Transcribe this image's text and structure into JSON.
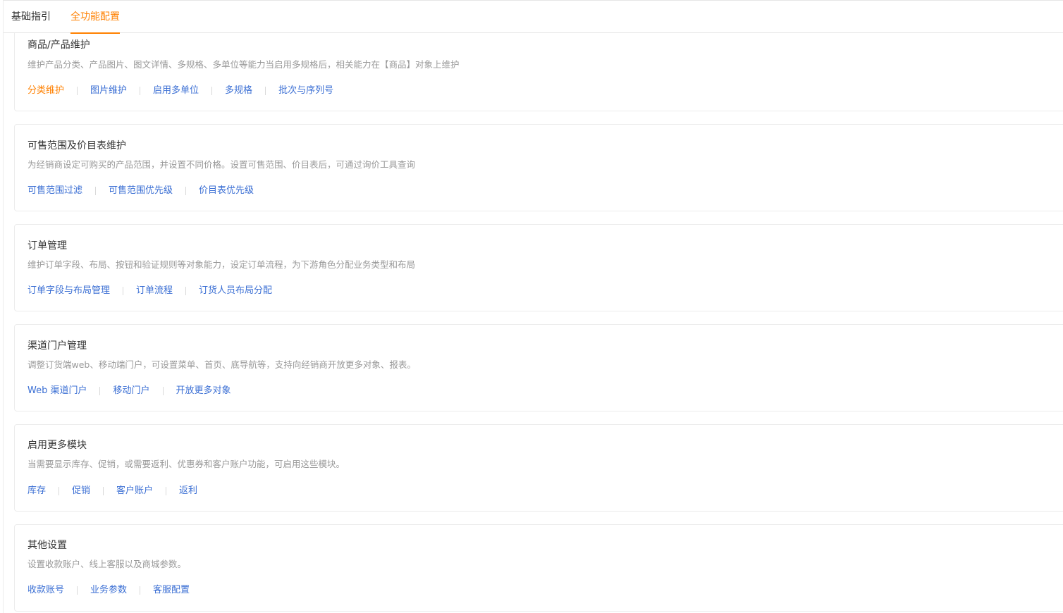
{
  "tabs": [
    {
      "label": "基础指引",
      "active": false
    },
    {
      "label": "全功能配置",
      "active": true
    }
  ],
  "colors": {
    "accent": "#ff8000",
    "link": "#3b6fd4",
    "muted": "#999999"
  },
  "sections": [
    {
      "title": "商品/产品维护",
      "desc": "维护产品分类、产品图片、图文详情、多规格、多单位等能力当启用多规格后，相关能力在【商品】对象上维护",
      "links": [
        "分类维护",
        "图片维护",
        "启用多单位",
        "多规格",
        "批次与序列号"
      ],
      "active_link": 0
    },
    {
      "title": "可售范围及价目表维护",
      "desc": "为经销商设定可购买的产品范围，并设置不同价格。设置可售范围、价目表后，可通过询价工具查询",
      "links": [
        "可售范围过滤",
        "可售范围优先级",
        "价目表优先级"
      ]
    },
    {
      "title": "订单管理",
      "desc": "维护订单字段、布局、按钮和验证规则等对象能力，设定订单流程，为下游角色分配业务类型和布局",
      "links": [
        "订单字段与布局管理",
        "订单流程",
        "订货人员布局分配"
      ]
    },
    {
      "title": "渠道门户管理",
      "desc": "调整订货端web、移动端门户，可设置菜单、首页、底导航等，支持向经销商开放更多对象、报表。",
      "links": [
        "Web 渠道门户",
        "移动门户",
        "开放更多对象"
      ]
    },
    {
      "title": "启用更多模块",
      "desc": "当需要显示库存、促销，或需要返利、优惠券和客户账户功能，可启用这些模块。",
      "links": [
        "库存",
        "促销",
        "客户账户",
        "返利"
      ]
    },
    {
      "title": "其他设置",
      "desc": "设置收款账户、线上客服以及商城参数。",
      "links": [
        "收款账号",
        "业务参数",
        "客服配置"
      ]
    }
  ]
}
